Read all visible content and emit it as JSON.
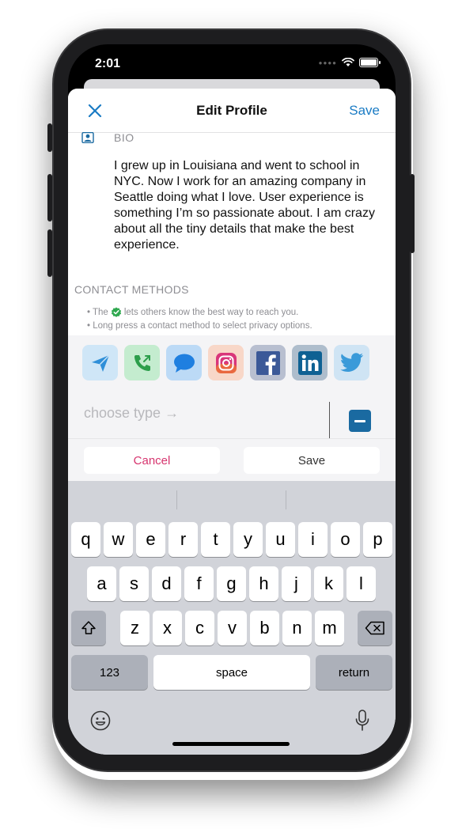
{
  "status": {
    "time": "2:01"
  },
  "nav": {
    "title": "Edit Profile",
    "save": "Save",
    "close_icon": "close-icon"
  },
  "bio": {
    "label": "BIO",
    "text": "I grew up in Louisiana and went to school in NYC. Now I work for an amazing company in Seattle doing what I love. User experience is something I’m so passionate about. I am crazy about all the tiny details that make the best experience."
  },
  "contact": {
    "header": "CONTACT METHODS",
    "hint1_pre": "• The",
    "hint1_post": "lets others know the best way to reach you.",
    "hint2": "• Long press a contact method to select privacy options.",
    "apps": [
      {
        "name": "send-icon",
        "bg": "#cfe6f7"
      },
      {
        "name": "phone-icon",
        "bg": "#c4eccf"
      },
      {
        "name": "message-icon",
        "bg": "#bcdaf6"
      },
      {
        "name": "instagram-icon",
        "bg": "#f8d7c8"
      },
      {
        "name": "facebook-icon",
        "bg": "#b8bfd0"
      },
      {
        "name": "linkedin-icon",
        "bg": "#aebdcc"
      },
      {
        "name": "twitter-icon",
        "bg": "#cfe4f4"
      }
    ],
    "type_placeholder": "choose type →",
    "cancel": "Cancel",
    "save": "Save"
  },
  "keyboard": {
    "row1": [
      "q",
      "w",
      "e",
      "r",
      "t",
      "y",
      "u",
      "i",
      "o",
      "p"
    ],
    "row2": [
      "a",
      "s",
      "d",
      "f",
      "g",
      "h",
      "j",
      "k",
      "l"
    ],
    "row3": [
      "z",
      "x",
      "c",
      "v",
      "b",
      "n",
      "m"
    ],
    "numbers": "123",
    "space": "space",
    "return": "return"
  },
  "colors": {
    "accent": "#1a7bc4",
    "cancel": "#d6346e",
    "minus": "#1a6aa1",
    "check": "#2fa84f"
  }
}
